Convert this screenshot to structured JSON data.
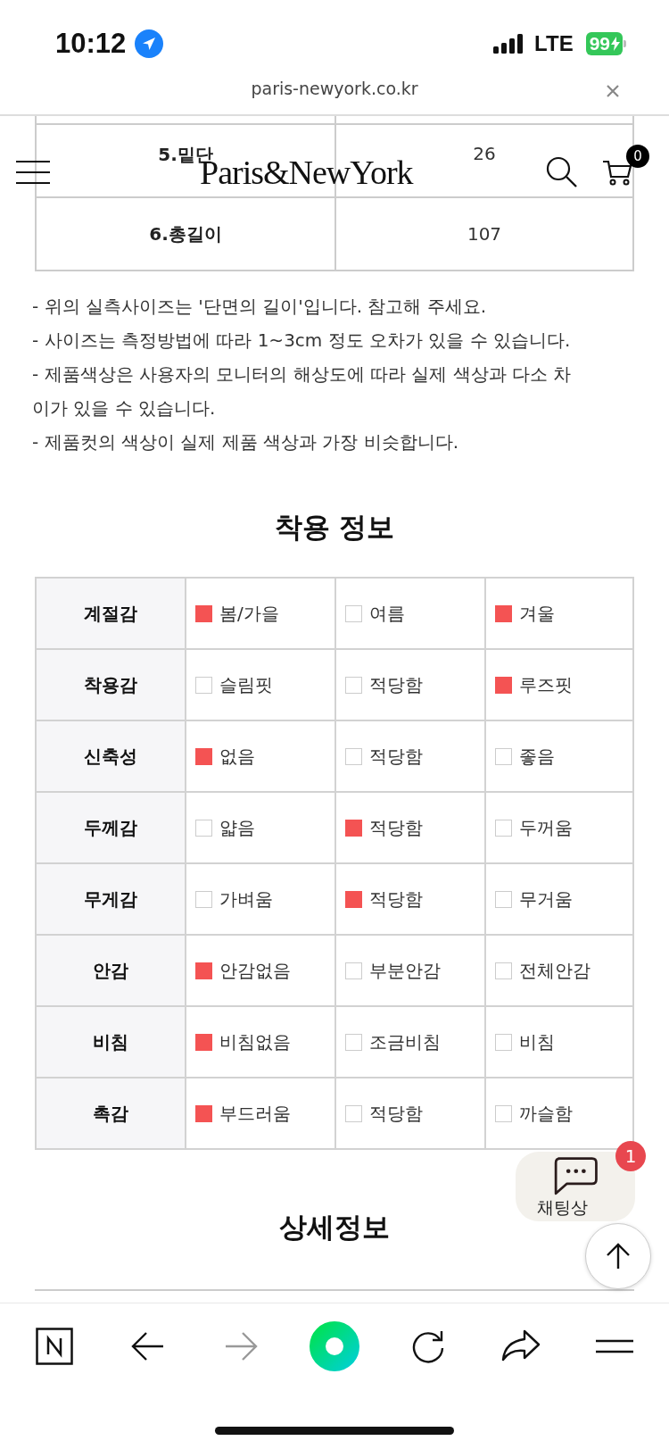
{
  "status_bar": {
    "time": "10:12",
    "network": "LTE",
    "battery": "99"
  },
  "url_bar": {
    "url": "paris-newyork.co.kr"
  },
  "header": {
    "logo": "Paris&NewYork",
    "cart_count": "0"
  },
  "size_table": {
    "rows": [
      {
        "label": "5.밑단",
        "value": "26"
      },
      {
        "label": "6.총길이",
        "value": "107"
      }
    ]
  },
  "notes": [
    "- 위의 실측사이즈는 '단면의 길이'입니다. 참고해 주세요.",
    "- 사이즈는 측정방법에 따라 1~3cm 정도 오차가 있을 수 있습니다.",
    "- 제품색상은 사용자의 모니터의 해상도에 따라 실제 색상과 다소 차이가 있을 수 있습니다.",
    "- 제품컷의 색상이 실제 제품 색상과 가장 비슷합니다."
  ],
  "fit_info": {
    "title": "착용 정보",
    "rows": [
      {
        "label": "계절감",
        "options": [
          {
            "label": "봄/가을",
            "checked": true
          },
          {
            "label": "여름",
            "checked": false
          },
          {
            "label": "겨울",
            "checked": true
          }
        ]
      },
      {
        "label": "착용감",
        "options": [
          {
            "label": "슬림핏",
            "checked": false
          },
          {
            "label": "적당함",
            "checked": false
          },
          {
            "label": "루즈핏",
            "checked": true
          }
        ]
      },
      {
        "label": "신축성",
        "options": [
          {
            "label": "없음",
            "checked": true
          },
          {
            "label": "적당함",
            "checked": false
          },
          {
            "label": "좋음",
            "checked": false
          }
        ]
      },
      {
        "label": "두께감",
        "options": [
          {
            "label": "얇음",
            "checked": false
          },
          {
            "label": "적당함",
            "checked": true
          },
          {
            "label": "두꺼움",
            "checked": false
          }
        ]
      },
      {
        "label": "무게감",
        "options": [
          {
            "label": "가벼움",
            "checked": false
          },
          {
            "label": "적당함",
            "checked": true
          },
          {
            "label": "무거움",
            "checked": false
          }
        ]
      },
      {
        "label": "안감",
        "options": [
          {
            "label": "안감없음",
            "checked": true
          },
          {
            "label": "부분안감",
            "checked": false
          },
          {
            "label": "전체안감",
            "checked": false
          }
        ]
      },
      {
        "label": "비침",
        "options": [
          {
            "label": "비침없음",
            "checked": true
          },
          {
            "label": "조금비침",
            "checked": false
          },
          {
            "label": "비침",
            "checked": false
          }
        ]
      },
      {
        "label": "촉감",
        "options": [
          {
            "label": "부드러움",
            "checked": true
          },
          {
            "label": "적당함",
            "checked": false
          },
          {
            "label": "까슬함",
            "checked": false
          }
        ]
      }
    ]
  },
  "detail_title": "상세정보",
  "chat": {
    "badge": "1",
    "label": "채팅상"
  }
}
